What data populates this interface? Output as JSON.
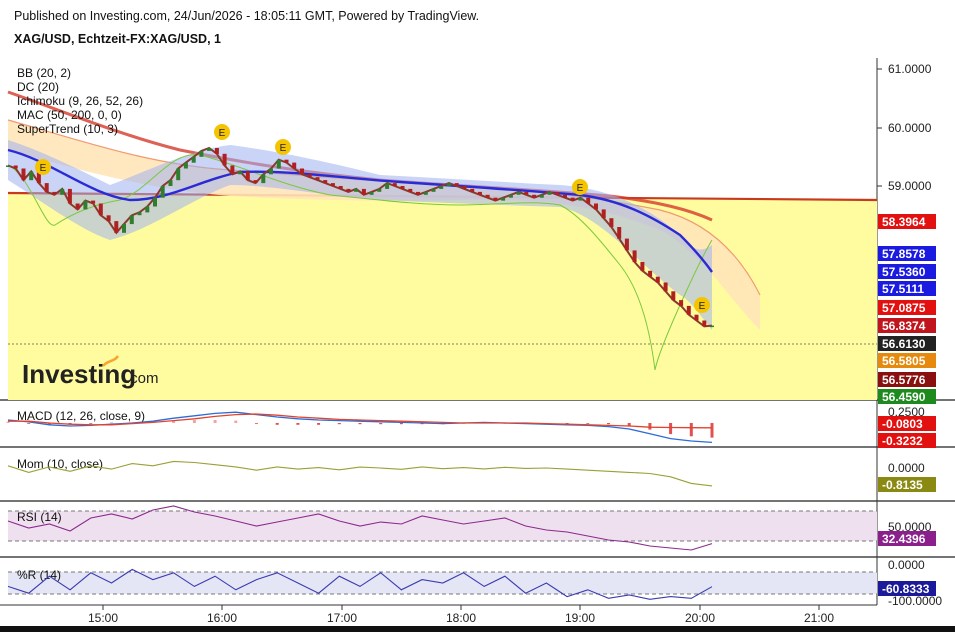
{
  "header": {
    "published_line": "Published on Investing.com, 24/Jun/2026 - 18:05:11 GMT, Powered by TradingView.",
    "symbol_line": "XAG/USD, Echtzeit-FX:XAG/USD, 1"
  },
  "logo": {
    "brand": "Investing",
    "suffix": ".com"
  },
  "colors": {
    "bb_fill": "#9fb0f0",
    "cloud_fill": "#ffe6b8",
    "supertrend_fill": "#fffca0",
    "ma_red": "#d43a2a",
    "ma_blue": "#2b2bd6",
    "donchian": "#3d8a3d",
    "lagging_green": "#7ac93a",
    "macd_line": "#2e6bd6",
    "macd_signal": "#e0442e",
    "mom_line": "#9aa033",
    "rsi_line": "#8b2a8b",
    "rsi_band": "#efe0f0",
    "wr_line": "#3b3bb0",
    "wr_band": "#e4e6f6",
    "signal_marker": "#f5c400"
  },
  "chart_data": [
    {
      "type": "line",
      "title": "XAG/USD, Echtzeit-FX:XAG/USD, 1",
      "indicators": [
        "BB (20, 2)",
        "DC (20)",
        "Ichimoku (9, 26, 52, 26)",
        "MAC (50, 200, 0, 0)",
        "SuperTrend (10, 3)"
      ],
      "x_ticks": [
        "15:00",
        "16:00",
        "17:00",
        "18:00",
        "19:00",
        "20:00",
        "21:00"
      ],
      "y_ticks": [
        "61.0000",
        "60.0000",
        "59.0000"
      ],
      "ylim": [
        56.45,
        61.1
      ],
      "price_labels": [
        {
          "value": "58.3964",
          "color": "#e31010"
        },
        {
          "value": "57.8578",
          "color": "#1a1ae0"
        },
        {
          "value": "57.5360",
          "color": "#1a1ae0"
        },
        {
          "value": "57.5111",
          "color": "#1a1ae0"
        },
        {
          "value": "57.0875",
          "color": "#e31010"
        },
        {
          "value": "56.8374",
          "color": "#c0151c"
        },
        {
          "value": "56.6130",
          "color": "#222222"
        },
        {
          "value": "56.5805",
          "color": "#e58a0c"
        },
        {
          "value": "56.5776",
          "color": "#8a1010"
        },
        {
          "value": "56.4590",
          "color": "#1d8a1d"
        }
      ],
      "close_series": [
        59.35,
        59.3,
        59.1,
        59.25,
        59.05,
        58.9,
        58.85,
        58.95,
        58.7,
        58.6,
        58.75,
        58.7,
        58.5,
        58.4,
        58.2,
        58.35,
        58.5,
        58.55,
        58.65,
        58.8,
        59.0,
        59.1,
        59.3,
        59.4,
        59.5,
        59.6,
        59.65,
        59.55,
        59.35,
        59.2,
        59.25,
        59.1,
        59.05,
        59.2,
        59.3,
        59.45,
        59.4,
        59.3,
        59.2,
        59.15,
        59.1,
        59.05,
        59.0,
        58.95,
        58.9,
        58.95,
        58.85,
        58.9,
        58.95,
        59.05,
        59.0,
        58.95,
        58.9,
        58.85,
        58.9,
        58.95,
        59.0,
        59.05,
        59.0,
        58.95,
        58.9,
        58.85,
        58.8,
        58.75,
        58.8,
        58.85,
        58.9,
        58.85,
        58.8,
        58.85,
        58.9,
        58.85,
        58.8,
        58.75,
        58.8,
        58.7,
        58.6,
        58.45,
        58.3,
        58.1,
        57.9,
        57.7,
        57.55,
        57.45,
        57.35,
        57.2,
        57.05,
        56.95,
        56.8,
        56.7,
        56.6,
        56.613
      ],
      "signal_markers": [
        "E",
        "E",
        "E",
        "E",
        "E"
      ]
    },
    {
      "type": "line",
      "title": "MACD (12, 26, close, 9)",
      "y_ticks": [
        "0.2500"
      ],
      "value_labels": [
        {
          "value": "-0.0803",
          "color": "#e31010"
        },
        {
          "value": "-0.3232",
          "color": "#e31010"
        }
      ],
      "series": [
        {
          "name": "MACD",
          "values": [
            0.05,
            0.02,
            -0.03,
            -0.05,
            -0.04,
            -0.02,
            0.0,
            0.03,
            0.08,
            0.12,
            0.16,
            0.18,
            0.14,
            0.1,
            0.07,
            0.05,
            0.04,
            0.03,
            0.02,
            0.01,
            0.0,
            -0.01,
            0.0,
            0.01,
            0.0,
            -0.01,
            -0.02,
            -0.03,
            -0.04,
            -0.06,
            -0.1,
            -0.18,
            -0.26,
            -0.3,
            -0.323
          ]
        },
        {
          "name": "Signal",
          "values": [
            0.03,
            0.03,
            0.0,
            -0.02,
            -0.03,
            -0.03,
            -0.01,
            0.01,
            0.04,
            0.07,
            0.11,
            0.14,
            0.15,
            0.13,
            0.1,
            0.08,
            0.06,
            0.05,
            0.04,
            0.03,
            0.02,
            0.01,
            0.0,
            0.0,
            0.0,
            0.0,
            -0.01,
            -0.02,
            -0.03,
            -0.04,
            -0.05,
            -0.07,
            -0.075,
            -0.078,
            -0.0803
          ]
        }
      ]
    },
    {
      "type": "line",
      "title": "Mom (10, close)",
      "y_ticks": [
        "0.0000"
      ],
      "value_labels": [
        {
          "value": "-0.8135",
          "color": "#8a8a12"
        }
      ],
      "series": [
        {
          "name": "Mom",
          "values": [
            0.1,
            -0.2,
            0.05,
            -0.15,
            0.1,
            -0.05,
            0.2,
            0.1,
            0.3,
            0.25,
            0.15,
            0.05,
            -0.1,
            0.05,
            -0.05,
            0.02,
            -0.08,
            0.04,
            0.0,
            -0.06,
            0.05,
            -0.03,
            0.02,
            -0.04,
            0.03,
            -0.02,
            0.0,
            -0.05,
            -0.1,
            -0.15,
            -0.2,
            -0.25,
            -0.4,
            -0.7,
            -0.8135
          ]
        }
      ]
    },
    {
      "type": "line",
      "title": "RSI (14)",
      "y_ticks": [
        "50.0000"
      ],
      "value_labels": [
        {
          "value": "32.4396",
          "color": "#8b1f8b"
        }
      ],
      "series": [
        {
          "name": "RSI",
          "values": [
            55,
            48,
            52,
            45,
            58,
            62,
            57,
            66,
            70,
            64,
            60,
            55,
            50,
            54,
            58,
            62,
            55,
            50,
            54,
            52,
            60,
            56,
            52,
            55,
            58,
            50,
            46,
            44,
            40,
            36,
            34,
            30,
            28,
            26,
            32.44
          ]
        }
      ]
    },
    {
      "type": "line",
      "title": "%R (14)",
      "y_ticks": [
        "0.0000",
        "-100.0000"
      ],
      "value_labels": [
        {
          "value": "-60.8333",
          "color": "#1a1a9a"
        }
      ],
      "series": [
        {
          "name": "%R",
          "values": [
            -60,
            -80,
            -30,
            -70,
            -20,
            -50,
            -10,
            -40,
            -20,
            -60,
            -30,
            -70,
            -40,
            -20,
            -50,
            -80,
            -30,
            -60,
            -20,
            -70,
            -40,
            -50,
            -20,
            -60,
            -30,
            -80,
            -50,
            -90,
            -70,
            -95,
            -85,
            -98,
            -90,
            -95,
            -60.83
          ]
        }
      ]
    }
  ]
}
